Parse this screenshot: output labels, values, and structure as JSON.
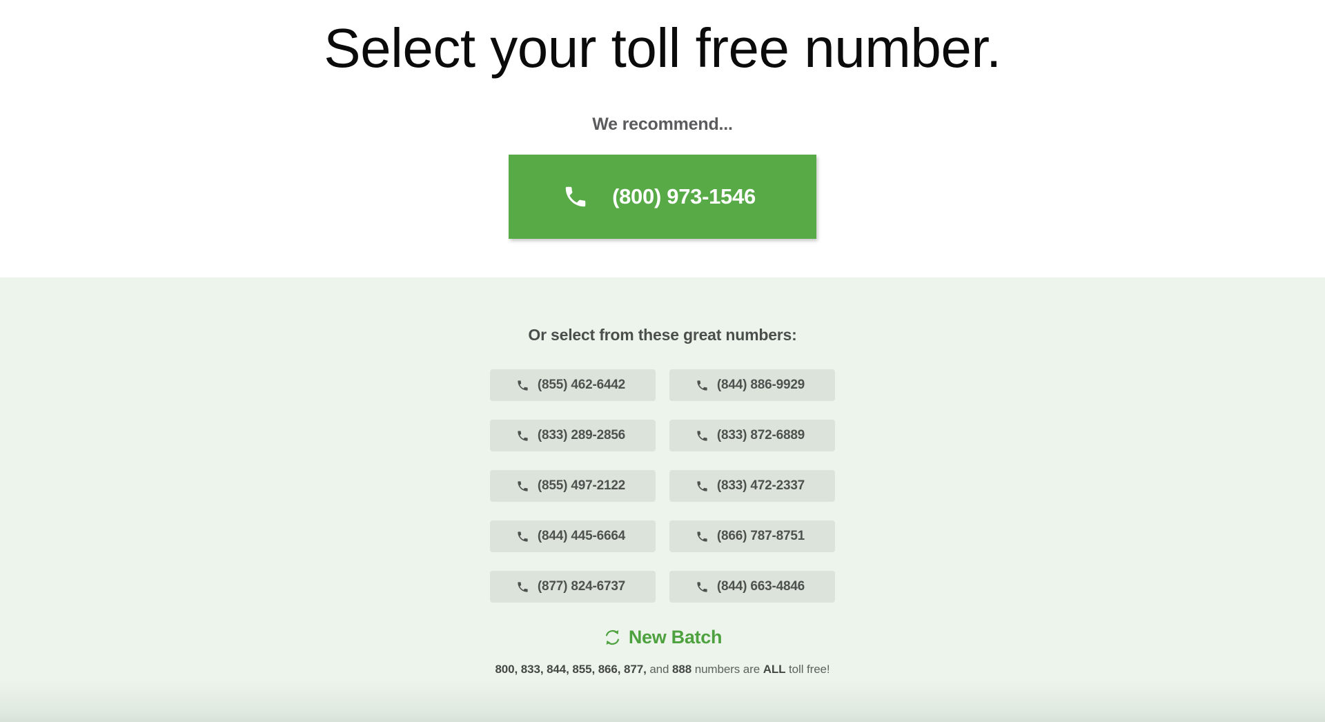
{
  "colors": {
    "hero_bg": "#ffffff",
    "picker_bg": "#ecf4ec",
    "accent_green": "#57aa46",
    "link_green": "#4da13e",
    "number_btn_bg": "#dce3db",
    "number_btn_text": "#4e524e",
    "heading_text": "#0b0b0b",
    "muted_text": "#5b5b5d"
  },
  "hero": {
    "title": "Select your toll free number.",
    "recommend_label": "We recommend...",
    "recommended_number": "(800) 973-1546",
    "phone_icon": "phone-icon"
  },
  "picker": {
    "label": "Or select from these great numbers:",
    "numbers": [
      "(855) 462-6442",
      "(844) 886-9929",
      "(833) 289-2856",
      "(833) 872-6889",
      "(855) 497-2122",
      "(833) 472-2337",
      "(844) 445-6664",
      "(866) 787-8751",
      "(877) 824-6737",
      "(844) 663-4846"
    ],
    "new_batch_label": "New Batch",
    "new_batch_icon": "refresh-icon",
    "footnote": {
      "prefixes": "800, 833, 844, 855, 866, 877,",
      "conjunction": " and ",
      "last_prefix": "888",
      "middle": " numbers are ",
      "emphasis": "ALL",
      "tail": " toll free!"
    }
  }
}
